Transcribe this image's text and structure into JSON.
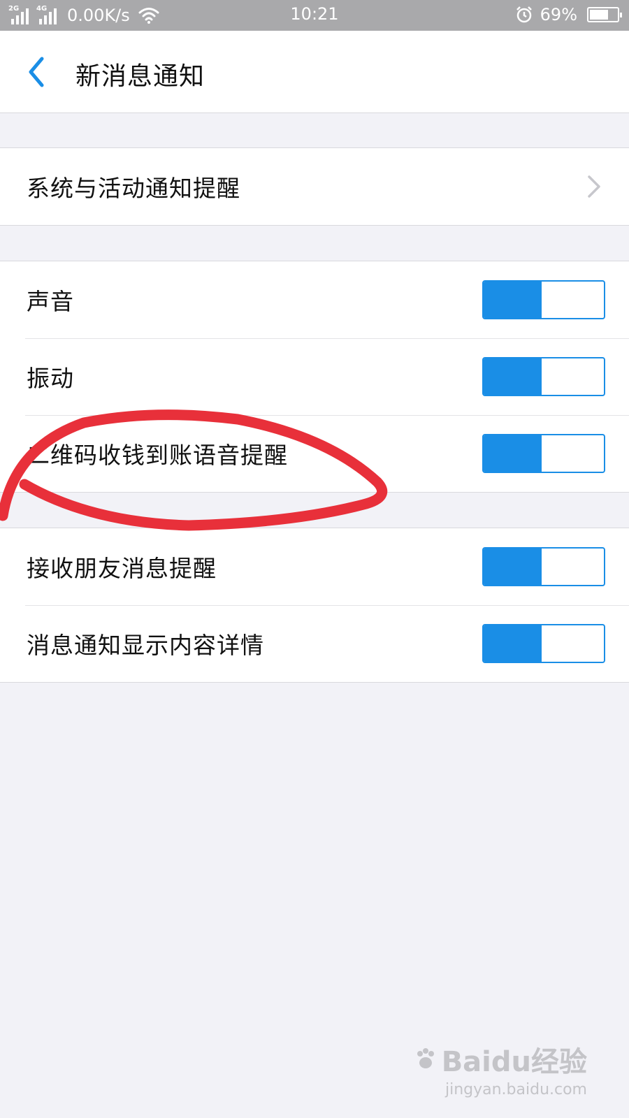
{
  "status_bar": {
    "sim1_tag": "2G",
    "sim2_tag": "4G",
    "speed": "0.00K/s",
    "time": "10:21",
    "battery_percent_text": "69%",
    "battery_level": 0.69
  },
  "nav": {
    "title": "新消息通知"
  },
  "groups": [
    {
      "rows": [
        {
          "label": "系统与活动通知提醒",
          "control": "chevron"
        }
      ]
    },
    {
      "rows": [
        {
          "label": "声音",
          "control": "toggle",
          "on": true
        },
        {
          "label": "振动",
          "control": "toggle",
          "on": true
        },
        {
          "label": "二维码收钱到账语音提醒",
          "control": "toggle",
          "on": true
        }
      ]
    },
    {
      "rows": [
        {
          "label": "接收朋友消息提醒",
          "control": "toggle",
          "on": true
        },
        {
          "label": "消息通知显示内容详情",
          "control": "toggle",
          "on": true
        }
      ]
    }
  ],
  "watermark": {
    "logo_text": "Baidu经验",
    "url_text": "jingyan.baidu.com"
  },
  "colors": {
    "accent": "#1a8ee6",
    "annotation": "#e8303a",
    "status_bar": "#a9a9ab"
  }
}
